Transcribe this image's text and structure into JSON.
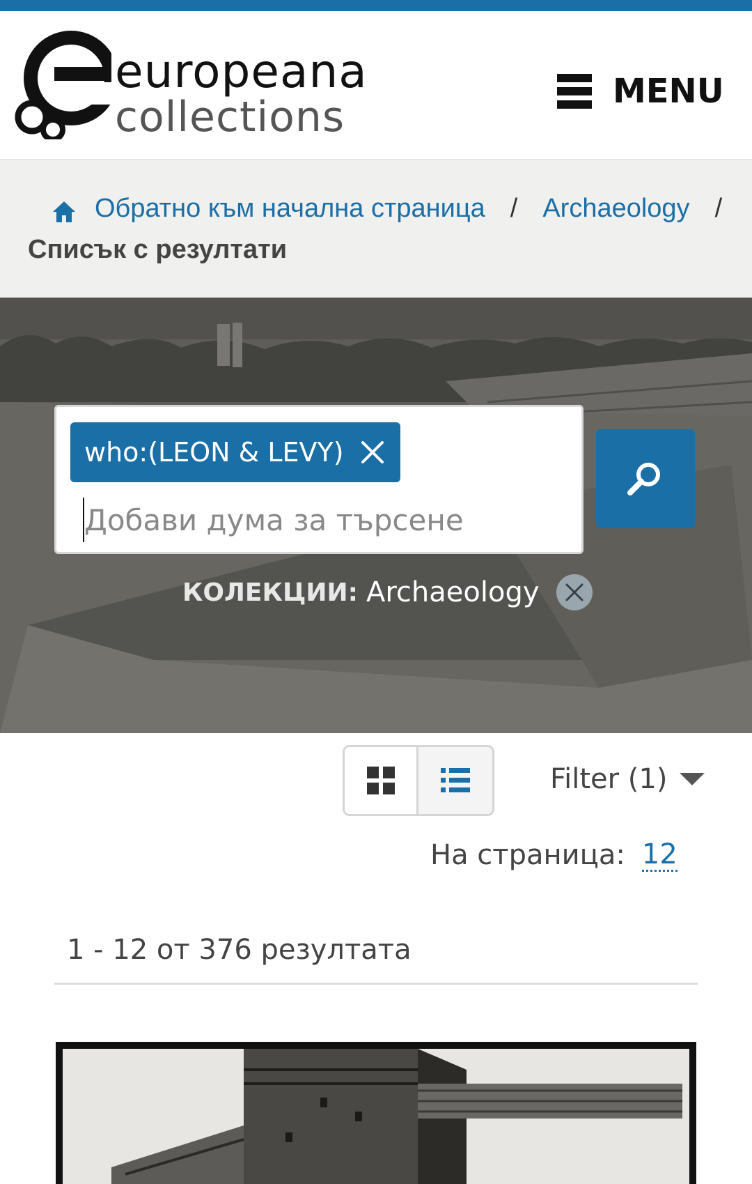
{
  "header": {
    "logo_line1": "europeana",
    "logo_line2": "collections",
    "menu_label": "MENU"
  },
  "breadcrumb": {
    "home_label": "Обратно към начална страница",
    "separator": "/",
    "collection_label": "Archaeology",
    "current": "Списък с резултати"
  },
  "search": {
    "query_chip": "who:(LEON & LEVY)",
    "placeholder": "Добави дума за търсене",
    "collection_filter_label": "КОЛЕКЦИИ:",
    "collection_filter_value": "Archaeology"
  },
  "toolbar": {
    "filter_label": "Filter (1)",
    "per_page_label": "На страница:",
    "per_page_value": "12"
  },
  "results": {
    "count_text": "1 - 12 от 376 резултата"
  },
  "colors": {
    "accent": "#1a6fa6",
    "breadcrumb_bg": "#f0f0ee"
  }
}
